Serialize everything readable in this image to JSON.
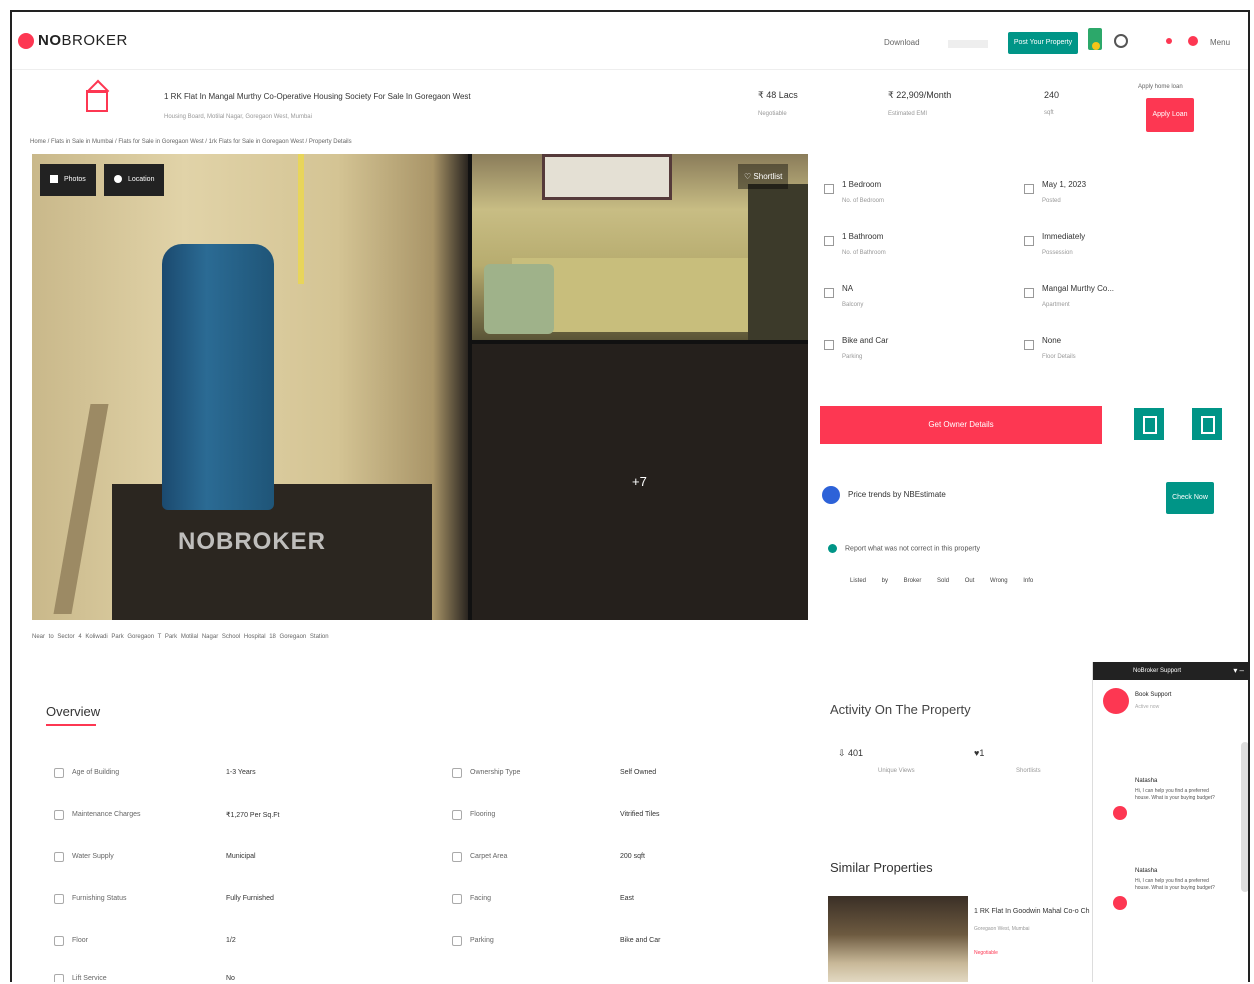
{
  "header": {
    "logo_main": "NO",
    "logo_rest": "BROKER",
    "download": "Download",
    "post_property_btn": "Post Your Property",
    "menu": "Menu"
  },
  "property": {
    "title": "1 RK Flat In Mangal Murthy Co-Operative Housing Society For Sale In Goregaon West",
    "subtitle": "Housing Board, Motilal Nagar, Goregaon West, Mumbai",
    "price": "₹ 48 Lacs",
    "price_sub": "Negotiable",
    "emi": "₹ 22,909/Month",
    "emi_sub": "Estimated EMI",
    "area": "240",
    "area_sub": "sqft",
    "apply_label": "Apply Loan",
    "apply_note": "Apply home loan"
  },
  "breadcrumb": "Home / Flats in Sale in Mumbai / Flats for Sale in Goregaon West / 1rk Flats for Sale in Goregaon West / Property Details",
  "gallery": {
    "photos_btn": "Photos",
    "location_btn": "Location",
    "shortlist": "Shortlist",
    "watermark": "NOBROKER",
    "more_count": "+7"
  },
  "tags": "Near to   Sector 4 Koliwadi Park   Goregaon T Park   Motilal Nagar School   Hospital 18   Goregaon Station",
  "details": [
    {
      "value": "1 Bedroom",
      "label": "No. of Bedroom"
    },
    {
      "value": "May 1, 2023",
      "label": "Posted"
    },
    {
      "value": "1 Bathroom",
      "label": "No. of Bathroom"
    },
    {
      "value": "Immediately",
      "label": "Possession"
    },
    {
      "value": "NA",
      "label": "Balcony"
    },
    {
      "value": "Mangal Murthy Co...",
      "label": "Apartment"
    },
    {
      "value": "Bike and Car",
      "label": "Parking"
    },
    {
      "value": "None",
      "label": "Floor Details"
    }
  ],
  "actions": {
    "owner_btn": "Get Owner Details",
    "trend": "Price trends by NBEstimate",
    "check_btn": "Check Now",
    "report": "Report what was not correct in this property",
    "report_opts": "Listed by Broker   Sold Out   Wrong Info"
  },
  "overview": {
    "title": "Overview",
    "rows": [
      {
        "l1": "Age of Building",
        "v1": "1-3 Years",
        "l2": "Ownership Type",
        "v2": "Self Owned"
      },
      {
        "l1": "Maintenance Charges",
        "v1": "₹1,270 Per Sq.Ft",
        "l2": "Flooring",
        "v2": "Vitrified Tiles"
      },
      {
        "l1": "Water Supply",
        "v1": "Municipal",
        "l2": "Carpet Area",
        "v2": "200 sqft"
      },
      {
        "l1": "Furnishing Status",
        "v1": "Fully Furnished",
        "l2": "Facing",
        "v2": "East"
      },
      {
        "l1": "Floor",
        "v1": "1/2",
        "l2": "Parking",
        "v2": "Bike and Car"
      },
      {
        "l1": "Lift Service",
        "v1": "No",
        "l2": "",
        "v2": ""
      }
    ]
  },
  "activity": {
    "title": "Activity On The Property",
    "views": "401",
    "views_label": "Unique Views",
    "shortlists": "1",
    "shortlists_label": "Shortlists"
  },
  "similar": {
    "title": "Similar Properties",
    "item_title": "1 RK Flat In Goodwin Mahal Co-o Ch",
    "item_sub": "Goregaon West, Mumbai",
    "item_tag": "Negotiable"
  },
  "chat": {
    "head": "NoBroker Support",
    "agent": "Book Support",
    "agent_sub": "Active now",
    "msgs": [
      {
        "name": "Natasha",
        "text": "Hi, I can help you find a preferred house. What is your buying budget?"
      },
      {
        "name": "Natasha",
        "text": "Hi, I can help you find a preferred house. What is your buying budget?"
      }
    ]
  }
}
